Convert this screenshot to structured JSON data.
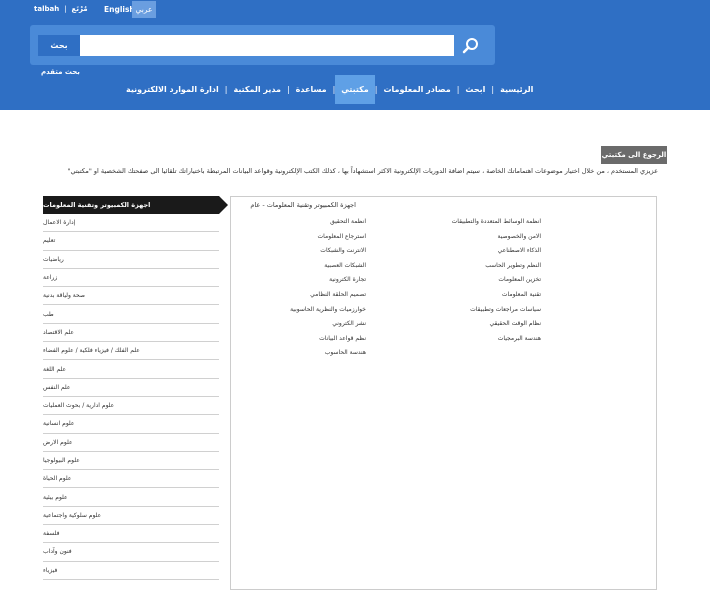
{
  "header": {
    "talbah_link": "talbah",
    "mutaa_link": "مُرْتَع",
    "lang_english": "English",
    "lang_arabic": "عربي",
    "search_button": "بحث",
    "search_placeholder": "",
    "advanced_search": "بحث متقدم"
  },
  "nav": {
    "items": [
      {
        "label": "الرئيسية"
      },
      {
        "label": "ابحث"
      },
      {
        "label": "مصادر المعلومات"
      },
      {
        "label": "مكتبتي"
      },
      {
        "label": "مساعدة"
      },
      {
        "label": "مدير المكتبة"
      },
      {
        "label": "ادارة الموارد الالكترونية"
      }
    ]
  },
  "main": {
    "back_button": "الرجوع الى مكتبتي",
    "intro_text": "عزيزي المستخدم ، من خلال اختيار موضوعات اهتماماتك الخاصة ، سيتم اضافة الدوريات الإلكترونية الاكثر استشهاداً بها ، كذلك الكتب الإلكترونية وقواعد البيانات المرتبطة باختياراتك تلقائيا الى صفحتك الشخصية او \"مكتبتي\"",
    "content_title": "اجهزة الكمبيوتر وتقنية المعلومات - عام",
    "col_right": [
      "انظمة الوسائط المتعددة والتطبيقات",
      "الامن والخصوصية",
      "الذكاء الاصطناعي",
      "النظم وتطوير الحاسب",
      "تخزين المعلومات",
      "تقنية المعلومات",
      "سياسات مراجعات وتطبيقات",
      "نظام الوقت الحقيقي",
      "هندسة البرمجيات"
    ],
    "col_left": [
      "انظمة التحقيق",
      "استرجاع المعلومات",
      "الانترنت والشبكات",
      "الشبكات العصبية",
      "تجارة الكترونية",
      "تصميم الحلقة النظامي",
      "خوارزميات والنظرية الحاسوبية",
      "نشر الكتروني",
      "نظم قواعد البيانات",
      "هندسة الحاسوب"
    ]
  },
  "sidebar": {
    "header": "اجهزة الكمبيوتر وتقنية المعلومات",
    "items": [
      {
        "label": "إدارة الاعمال"
      },
      {
        "label": "تعليم"
      },
      {
        "label": "رياضيات"
      },
      {
        "label": "زراعة"
      },
      {
        "label": "صحة ولياقة بدنية"
      },
      {
        "label": "طب"
      },
      {
        "label": "علم الاقتصاد"
      },
      {
        "label": "علم الفلك / فيزياء فلكية / علوم الفضاء"
      },
      {
        "label": "علم اللغة"
      },
      {
        "label": "علم النفس"
      },
      {
        "label": "علوم ادارية / بحوث العمليات"
      },
      {
        "label": "علوم انسانية"
      },
      {
        "label": "علوم الارض"
      },
      {
        "label": "علوم البيولوجيا"
      },
      {
        "label": "علوم الحياة"
      },
      {
        "label": "علوم بيئية"
      },
      {
        "label": "علوم سلوكية واجتماعية"
      },
      {
        "label": "فلسفة"
      },
      {
        "label": "فنون وآداب"
      },
      {
        "label": "فيزياء"
      }
    ]
  },
  "colors": {
    "header_bg": "#2f6fc4",
    "search_panel": "#4a8ad8",
    "active_tab": "#5fa0e6",
    "back_button": "#6b6b6b",
    "sidebar_head": "#1a1a1a"
  }
}
